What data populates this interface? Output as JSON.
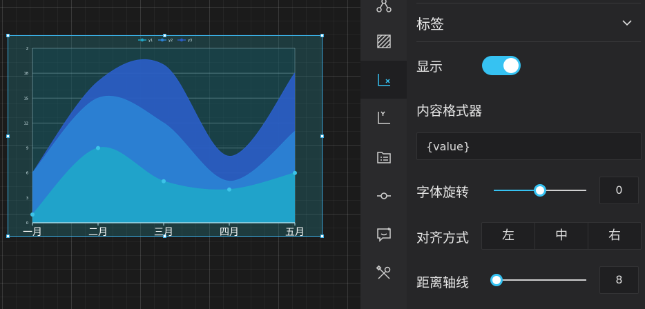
{
  "chart_data": {
    "type": "area",
    "title": "",
    "xlabel": "",
    "ylabel": "",
    "categories": [
      "一月",
      "二月",
      "三月",
      "四月",
      "五月"
    ],
    "ylim": [
      0,
      21
    ],
    "y_ticks": [
      "0",
      "3",
      "6",
      "9",
      "12",
      "15",
      "18",
      "2"
    ],
    "stacked": true,
    "legend_position": "top",
    "grid": true,
    "series": [
      {
        "name": "y1",
        "values": [
          1,
          9,
          5,
          4,
          6
        ],
        "color": "#1fa6c9",
        "markers": true
      },
      {
        "name": "y2",
        "values": [
          5,
          6,
          7,
          1,
          5
        ],
        "color": "#2b82d4",
        "markers": false
      },
      {
        "name": "y3",
        "values": [
          0,
          2,
          7,
          3,
          7
        ],
        "color": "#2a5dc6",
        "markers": false
      }
    ]
  },
  "rail": {
    "items": [
      {
        "icon": "node-graph-icon"
      },
      {
        "icon": "hatch-fill-icon"
      },
      {
        "icon": "x-axis-icon"
      },
      {
        "icon": "y-axis-icon"
      },
      {
        "icon": "legend-list-icon"
      },
      {
        "icon": "data-point-icon"
      },
      {
        "icon": "tooltip-icon"
      },
      {
        "icon": "tools-icon"
      }
    ]
  },
  "panel": {
    "section_title": "标签",
    "show_label": "显示",
    "show_enabled": true,
    "formatter_label": "内容格式器",
    "formatter_value": "{value}",
    "rotate_label": "字体旋转",
    "rotate_value": "0",
    "rotate_fraction": 0.5,
    "align_label": "对齐方式",
    "align_options": [
      "左",
      "中",
      "右"
    ],
    "distance_label": "距离轴线",
    "distance_value": "8",
    "distance_fraction": 0.0,
    "accent_color": "#36c2f2"
  }
}
